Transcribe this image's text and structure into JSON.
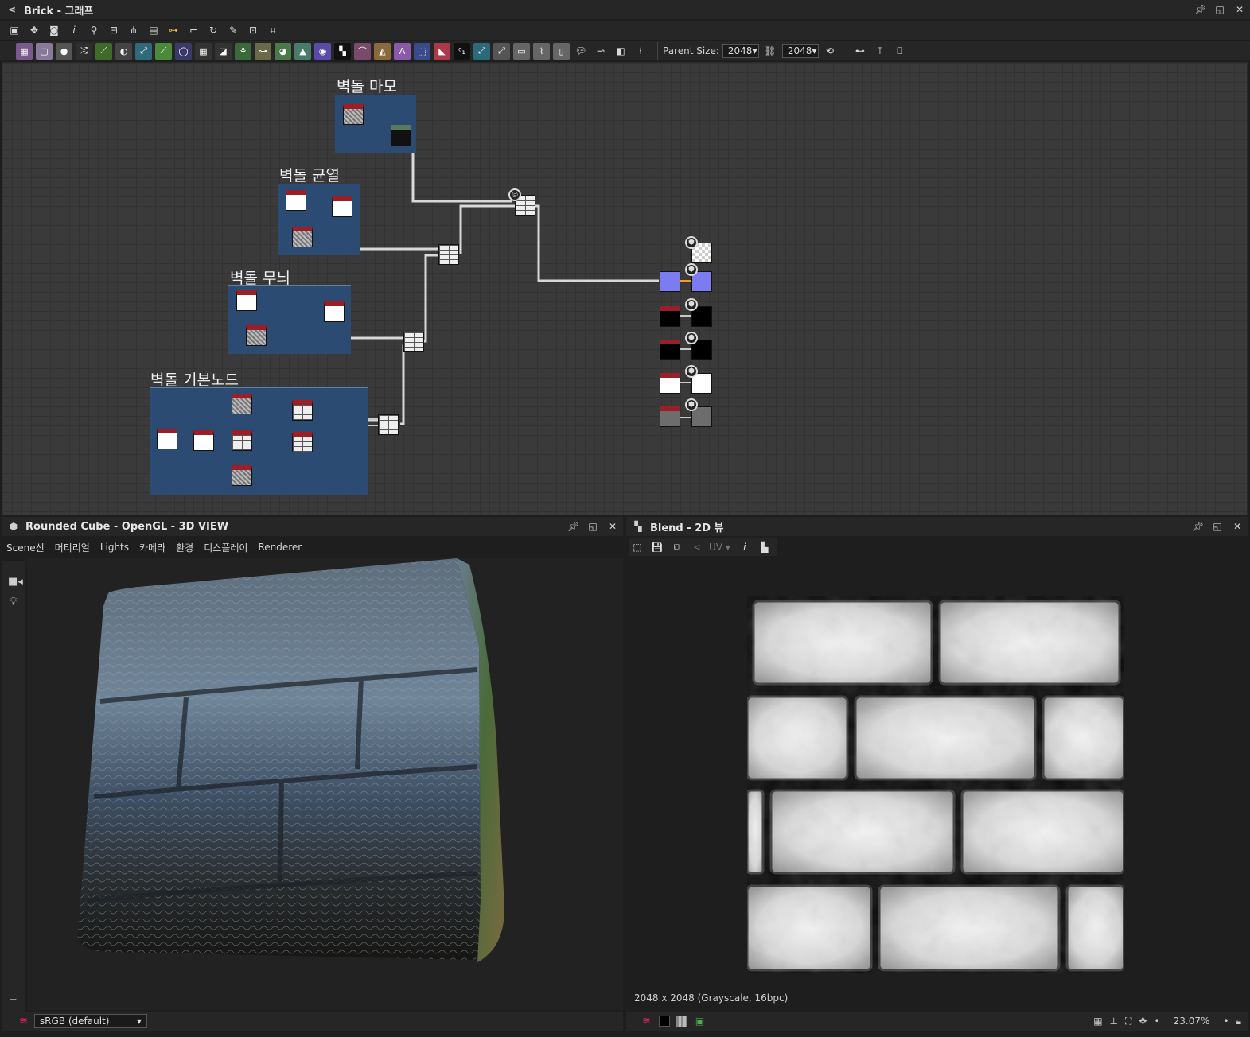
{
  "graph_window": {
    "title": "Brick - 그래프",
    "parent_size_label": "Parent Size:",
    "size_w": "2048",
    "size_h": "2048",
    "frames": [
      "벽돌 마모",
      "벽돌 균열",
      "벽돌 무늬",
      "벽돌 기본노드"
    ]
  },
  "view3d": {
    "title": "Rounded Cube - OpenGL - 3D VIEW",
    "menu": [
      "Scene신",
      "머티리얼",
      "Lights",
      "카메라",
      "환경",
      "디스플레이",
      "Renderer"
    ],
    "colorspace": "sRGB (default)"
  },
  "view2d": {
    "title": "Blend - 2D 뷰",
    "uv_label": "UV",
    "info": "2048 x 2048 (Grayscale, 16bpc)",
    "zoom": "23.07%"
  },
  "icons": {
    "window": "graph-icon",
    "pin": "pin-icon",
    "maximize": "maximize-icon",
    "close": "close-icon"
  }
}
